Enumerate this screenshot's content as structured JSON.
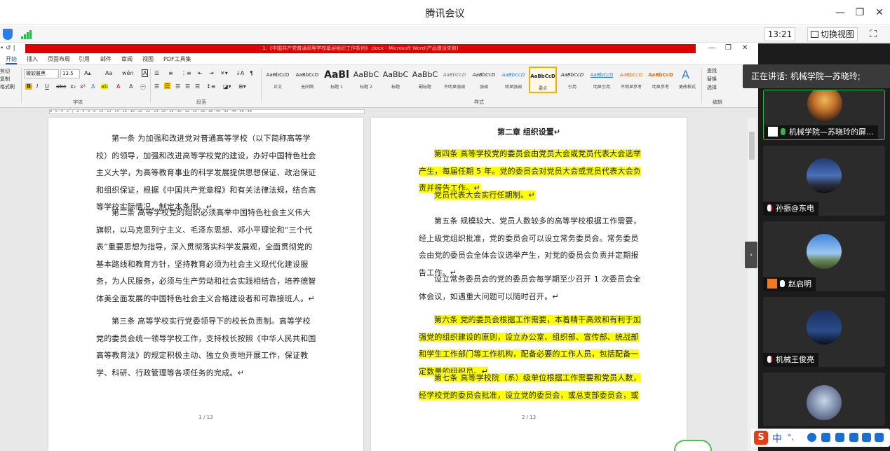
{
  "window": {
    "title": "腾讯会议",
    "minimize": "—",
    "restore": "❐",
    "close": "✕"
  },
  "topbar": {
    "time": "13:21",
    "switch_view": "切换视图",
    "fullscreen": "⛶"
  },
  "word": {
    "quick_access": "• ↺ |",
    "doc_title": "1.《中国共产党普通高等学校基层组织工作条例》.docx - Microsoft Word(产品激活失败)",
    "tabs": [
      "开始",
      "插入",
      "页面布局",
      "引用",
      "邮件",
      "审阅",
      "视图",
      "PDF工具集"
    ],
    "clipboard": [
      "剪切",
      "复制",
      "格式刷"
    ],
    "font_name": "微软雅黑",
    "font_size": "13.5",
    "group_labels": {
      "font": "字体",
      "paragraph": "段落",
      "styles": "样式",
      "edit": "编辑"
    },
    "edit_items": [
      "查找",
      "替换",
      "选择"
    ],
    "change_styles": "更改样式",
    "styles": [
      {
        "sample": "AaBbCcD",
        "name": "正文"
      },
      {
        "sample": "AaBbCcD",
        "name": "无间隔"
      },
      {
        "sample": "AaBl",
        "name": "标题 1"
      },
      {
        "sample": "AaBbC",
        "name": "标题 2"
      },
      {
        "sample": "AaBbC",
        "name": "标题"
      },
      {
        "sample": "AaBbC",
        "name": "副标题"
      },
      {
        "sample": "AaBbCcD",
        "name": "不明显强调"
      },
      {
        "sample": "AaBbCcD",
        "name": "强调"
      },
      {
        "sample": "AaBbCcD",
        "name": "明显强调"
      },
      {
        "sample": "AaBbCcD",
        "name": "要点"
      },
      {
        "sample": "AaBbCcD",
        "name": "引用"
      },
      {
        "sample": "AaBbCcD",
        "name": "明显引用"
      },
      {
        "sample": "AaBbCcD",
        "name": "不明显参考"
      },
      {
        "sample": "AaBbCcD",
        "name": "明显参考"
      }
    ],
    "ruler_ticks": "8 · 6 · 4 · 2 · | · 2 · 4 · 6 · 8 · 10 · 12 · 14 · 16 · 18 · 20 · 22 · 24 · 26 · 28 · 30 · 32 · 34 · 36 · 38 · 40 · 42 · 44 · 46 · 48"
  },
  "page1": {
    "paragraphs": [
      "第一条 为加强和改进党对普通高等学校（以下简称高等学校）的领导，加强和改进高等学校党的建设，办好中国特色社会主义大学，为高等教育事业的科学发展提供思想保证、政治保证和组织保证，根据《中国共产党章程》和有关法律法规，结合高等学校实际情况，制定本条例。↵",
      "第二条 高等学校党的组织必须高举中国特色社会主义伟大旗帜，以马克思列宁主义、毛泽东思想、邓小平理论和“三个代表”重要思想为指导，深入贯彻落实科学发展观，全面贯彻党的基本路线和教育方针，坚持教育必须为社会主义现代化建设服务，为人民服务，必须与生产劳动和社会实践相结合，培养德智体美全面发展的中国特色社会主义合格建设者和可靠接班人。↵",
      "第三条 高等学校实行党委领导下的校长负责制。高等学校党的委员会统一领导学校工作，支持校长按照《中华人民共和国高等教育法》的规定积极主动、独立负责地开展工作，保证教学、科研、行政管理等各项任务的完成。↵"
    ],
    "page_num": "1 / 13"
  },
  "page2": {
    "chapter": "第二章  组织设置↵",
    "p4": "第四条 高等学校党的委员会由党员大会或党员代表大会选举产生，每届任期 5 年。党的委员会对党员大会或党员代表大会负责并报告工作。↵",
    "p4b": "党员代表大会实行任期制。↵",
    "p5": "第五条 规模较大、党员人数较多的高等学校根据工作需要，经上级党组织批准，党的委员会可以设立常务委员会。常务委员会由党的委员会全体会议选举产生，对党的委员会负责并定期报告工作。↵",
    "p5b": "设立常务委员会的党的委员会每学期至少召开 1 次委员会全体会议，如遇重大问题可以随时召开。↵",
    "p6": "第六条 党的委员会根据工作需要，本着精干高效和有利于加强党的组织建设的原则，设立办公室、组织部、宣传部、统战部和学生工作部门等工作机构，配备必要的工作人员，包括配备一定数量的组织员。↵",
    "p7": "第七条 高等学校院（系）级单位根据工作需要和党员人数，经学校党的委员会批准，设立党的委员会，或总支部委员会，或直属支部委",
    "page_num": "2 / 13"
  },
  "sidebar": {
    "speaking": "正在讲话: 机械学院—苏晓玲;",
    "participants": [
      {
        "name": "机械学院—苏晓玲的屏..."
      },
      {
        "name": "孙振@东电"
      },
      {
        "name": "赵启明"
      },
      {
        "name": "机械王俊亮"
      }
    ],
    "collapse": "›"
  },
  "ime": {
    "logo": "S",
    "lang": "中",
    "punct": "°,"
  },
  "colors": {
    "highlight": "#ffff00",
    "active_tile": "#2fb54a",
    "sidebar_bg": "#1c1c1c",
    "doc_title_bar": "#e00000"
  }
}
